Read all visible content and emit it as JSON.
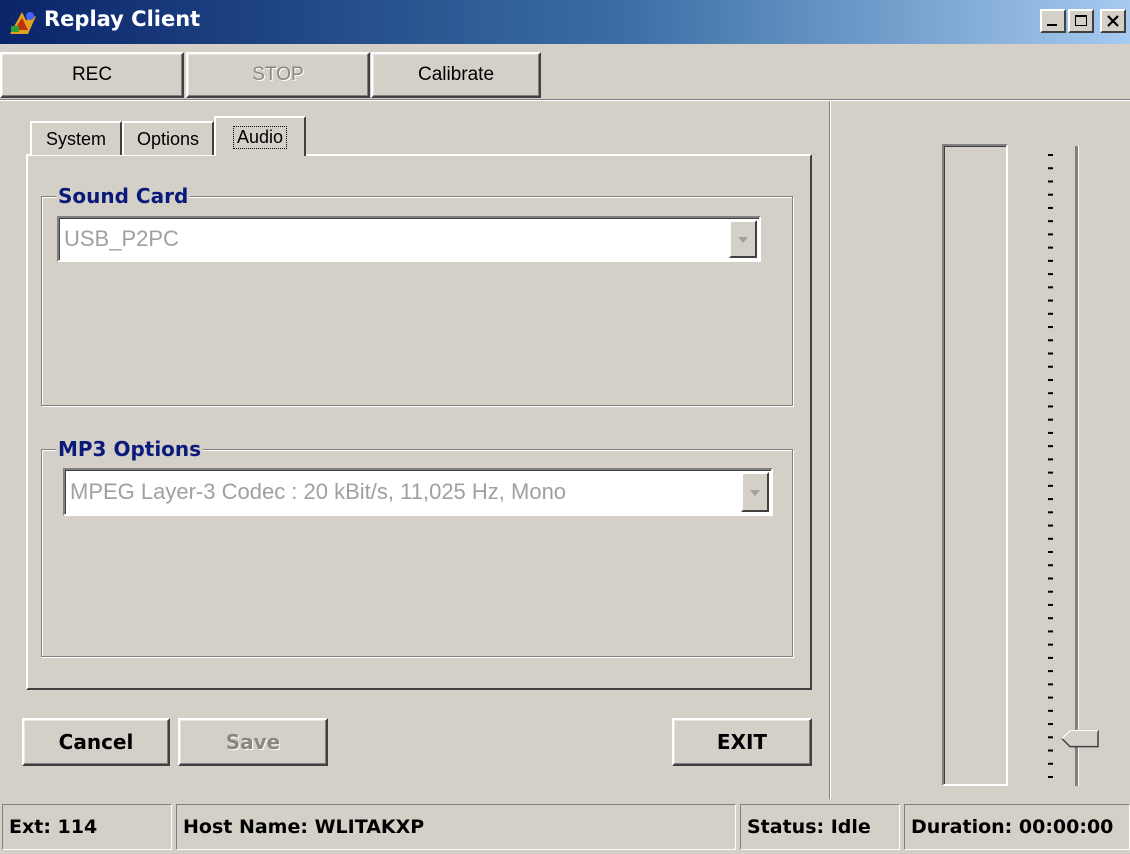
{
  "window": {
    "title": "Replay Client",
    "icons": {
      "app": "replay-app-icon",
      "minimize": "minimize-icon",
      "maximize": "maximize-icon",
      "close": "close-icon"
    }
  },
  "toolbar": {
    "rec_label": "REC",
    "stop_label": "STOP",
    "stop_enabled": false,
    "calibrate_label": "Calibrate"
  },
  "tabs": [
    {
      "label": "System",
      "active": false
    },
    {
      "label": "Options",
      "active": false
    },
    {
      "label": "Audio",
      "active": true
    }
  ],
  "sound_card": {
    "group_label": "Sound Card",
    "selected": "USB_P2PC",
    "enabled": false
  },
  "mp3_options": {
    "group_label": "MP3 Options",
    "selected": "MPEG Layer-3 Codec : 20 kBit/s, 11,025 Hz, Mono",
    "enabled": false
  },
  "actions": {
    "cancel_label": "Cancel",
    "save_label": "Save",
    "save_enabled": false,
    "exit_label": "EXIT"
  },
  "volume": {
    "slider_level": 0.06,
    "level_meter": 0
  },
  "status_bar": {
    "ext": "Ext: 114",
    "host": "Host Name: WLITAKXP",
    "status": "Status: Idle",
    "duration": "Duration: 00:00:00"
  },
  "colors": {
    "face": "#d4d0c8",
    "title_start": "#0a246a",
    "title_end": "#a6caf0",
    "group_label": "#0a1a7a",
    "disabled_text": "#a0a0a0"
  }
}
